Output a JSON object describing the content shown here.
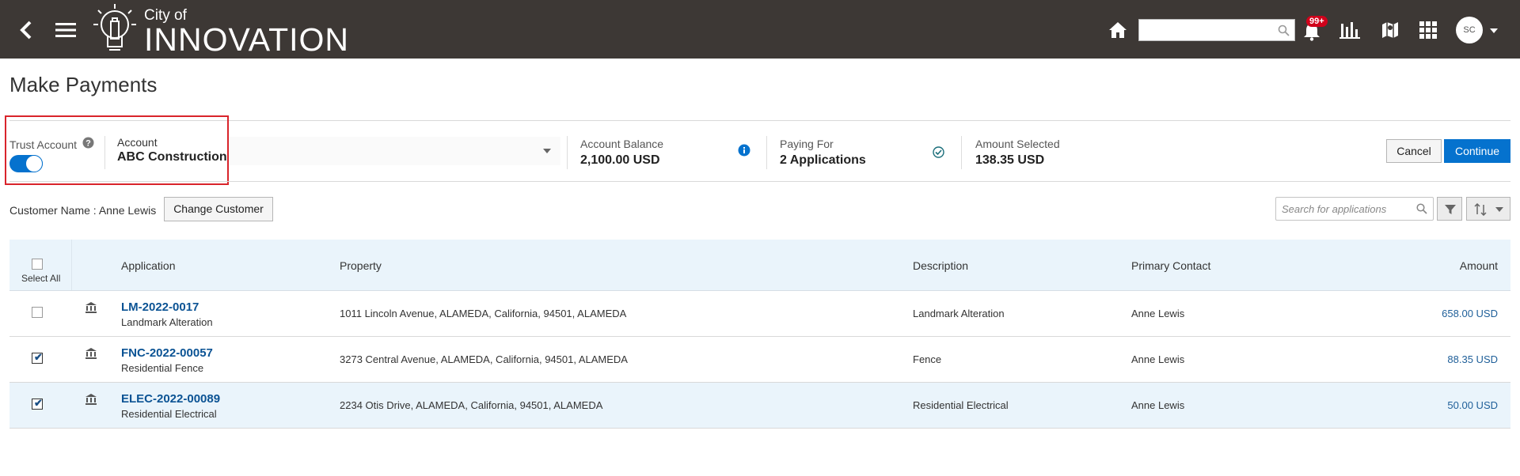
{
  "header": {
    "brand_small": "City of",
    "brand_large": "INNOVATION",
    "notification_count": "99+",
    "user_initials": "SC",
    "icons": [
      "back-arrow-icon",
      "hamburger-menu-icon",
      "lightbulb-logo-icon",
      "home-icon",
      "search-icon",
      "bell-icon",
      "bar-chart-icon",
      "map-icon",
      "grid-apps-icon",
      "chevron-down-icon"
    ]
  },
  "page": {
    "title": "Make Payments"
  },
  "summary": {
    "trust_account_label": "Trust Account",
    "trust_account_enabled": true,
    "account_label": "Account",
    "account_value": "ABC Construction",
    "balance_label": "Account Balance",
    "balance_value": "2,100.00 USD",
    "paying_for_label": "Paying For",
    "paying_for_value": "2 Applications",
    "amount_selected_label": "Amount Selected",
    "amount_selected_value": "138.35 USD"
  },
  "actions": {
    "cancel": "Cancel",
    "continue": "Continue"
  },
  "customer": {
    "label": "Customer Name : Anne Lewis",
    "change_button": "Change Customer"
  },
  "search": {
    "placeholder": "Search for applications"
  },
  "table": {
    "select_all": "Select All",
    "columns": {
      "application": "Application",
      "property": "Property",
      "description": "Description",
      "primary_contact": "Primary Contact",
      "amount": "Amount"
    },
    "rows": [
      {
        "checked": false,
        "app_id": "LM-2022-0017",
        "app_type": "Landmark Alteration",
        "property": "1011 Lincoln Avenue, ALAMEDA, California, 94501, ALAMEDA",
        "description": "Landmark Alteration",
        "contact": "Anne Lewis",
        "amount": "658.00 USD"
      },
      {
        "checked": true,
        "app_id": "FNC-2022-00057",
        "app_type": "Residential Fence",
        "property": "3273 Central Avenue, ALAMEDA, California, 94501, ALAMEDA",
        "description": "Fence",
        "contact": "Anne Lewis",
        "amount": "88.35 USD"
      },
      {
        "checked": true,
        "app_id": "ELEC-2022-00089",
        "app_type": "Residential Electrical",
        "property": "2234 Otis Drive, ALAMEDA, California, 94501, ALAMEDA",
        "description": "Residential Electrical",
        "contact": "Anne Lewis",
        "amount": "50.00 USD"
      }
    ]
  },
  "colors": {
    "header_bg": "#3d3835",
    "primary": "#0572ce",
    "highlight_row": "#eaf4fb",
    "annotation_red": "#d9242b"
  }
}
